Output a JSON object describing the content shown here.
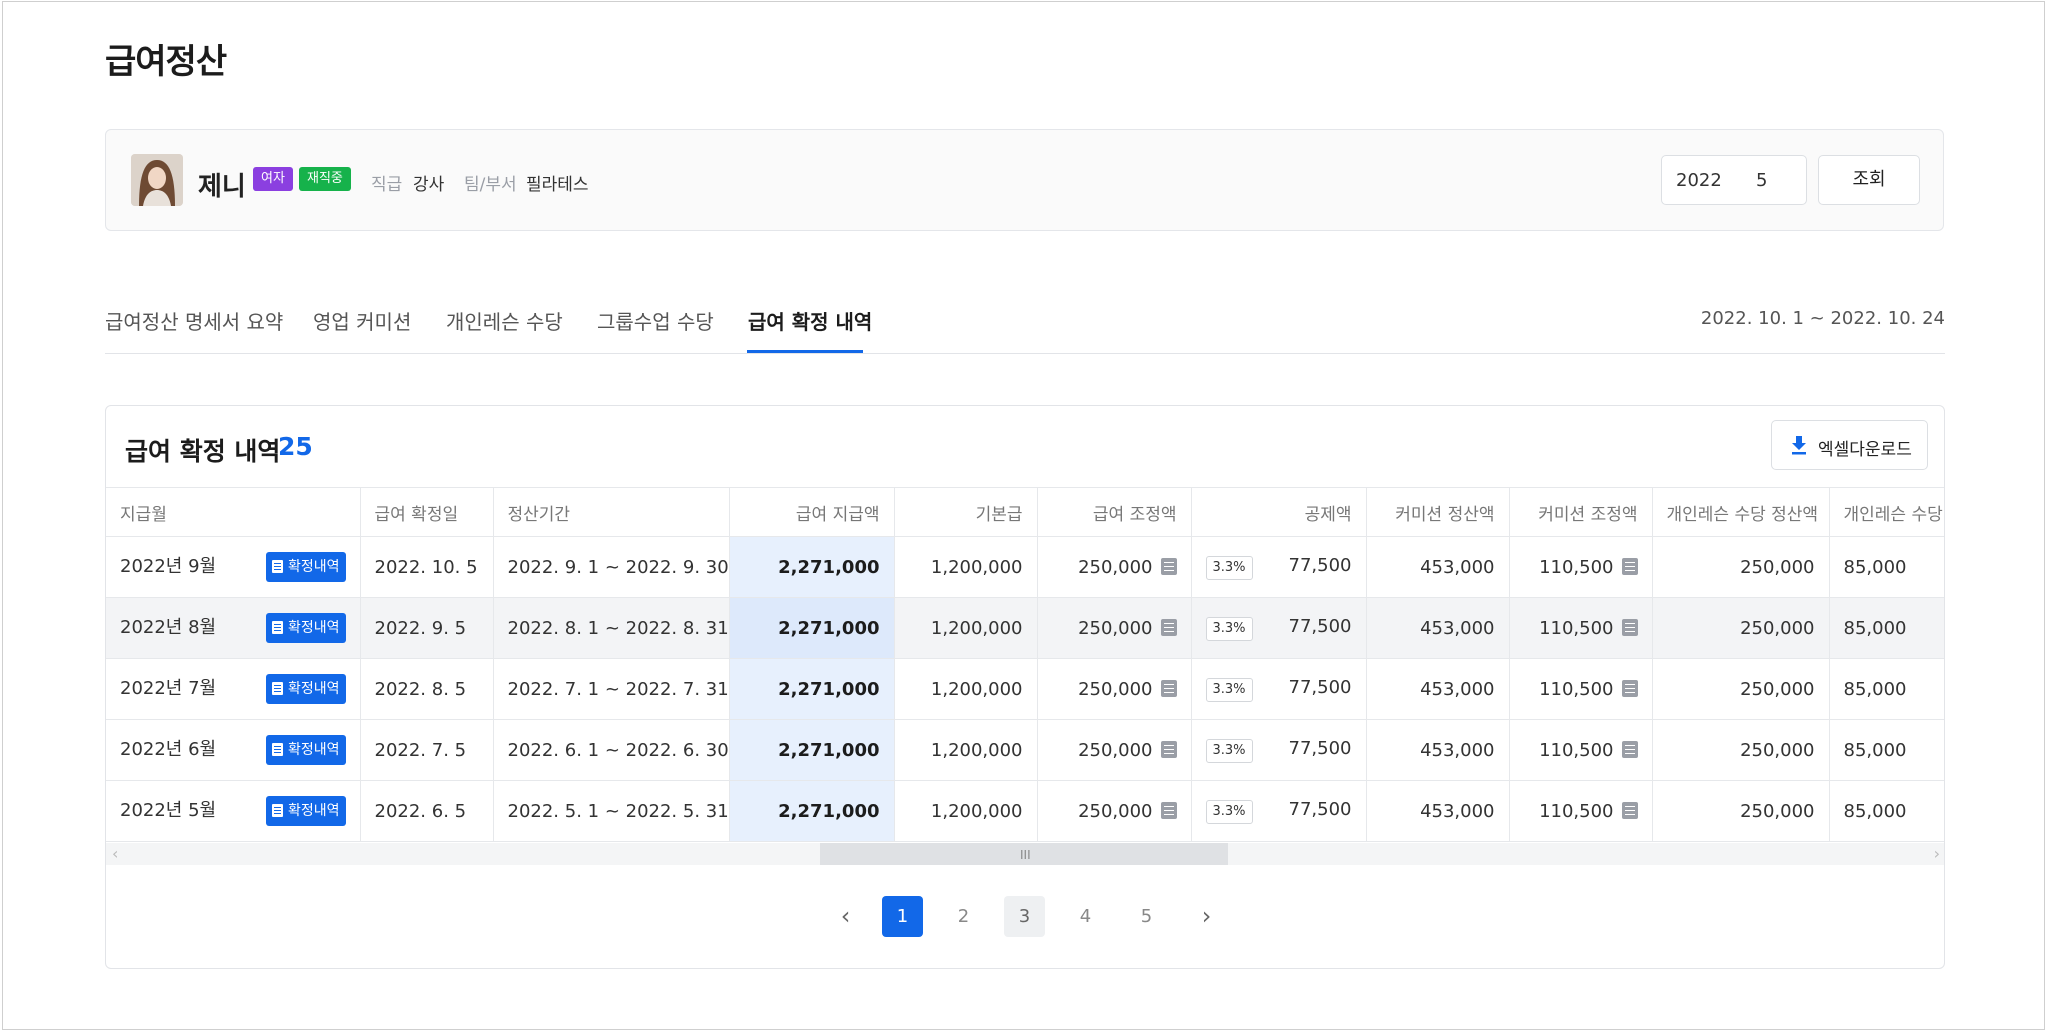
{
  "page": {
    "title": "급여정산"
  },
  "profile": {
    "name": "제니",
    "gender_badge": "여자",
    "status_badge": "재직중",
    "position_label": "직급",
    "position_value": "강사",
    "team_label": "팀/부서",
    "team_value": "필라테스",
    "year": "2022",
    "month": "5",
    "search_label": "조회"
  },
  "tabs": [
    {
      "label": "급여정산 명세서 요약",
      "active": false
    },
    {
      "label": "영업 커미션",
      "active": false
    },
    {
      "label": "개인레슨 수당",
      "active": false
    },
    {
      "label": "그룹수업 수당",
      "active": false
    },
    {
      "label": "급여 확정 내역",
      "active": true
    }
  ],
  "period": "2022. 10. 1 ~ 2022. 10. 24",
  "table": {
    "title": "급여 확정 내역",
    "count": "25",
    "excel_label": "엑셀다운로드",
    "confirm_label": "확정내역",
    "tax_label": "3.3%",
    "headers": [
      "지급월",
      "급여 확정일",
      "정산기간",
      "급여 지급액",
      "기본급",
      "급여 조정액",
      "공제액",
      "커미션 정산액",
      "커미션 조정액",
      "개인레슨 수당 정산액",
      "개인레슨 수당 조정액"
    ],
    "rows": [
      {
        "month": "2022년 9월",
        "confirm_date": "2022. 10. 5",
        "period": "2022. 9. 1 ~ 2022. 9. 30",
        "pay": "2,271,000",
        "base": "1,200,000",
        "adjust": "250,000",
        "deduct": "77,500",
        "commission": "453,000",
        "commission_adj": "110,500",
        "lesson": "250,000",
        "lesson_adj": "85,000"
      },
      {
        "month": "2022년 8월",
        "confirm_date": "2022. 9. 5",
        "period": "2022. 8. 1 ~ 2022. 8. 31",
        "pay": "2,271,000",
        "base": "1,200,000",
        "adjust": "250,000",
        "deduct": "77,500",
        "commission": "453,000",
        "commission_adj": "110,500",
        "lesson": "250,000",
        "lesson_adj": "85,000"
      },
      {
        "month": "2022년 7월",
        "confirm_date": "2022. 8. 5",
        "period": "2022. 7. 1 ~ 2022. 7. 31",
        "pay": "2,271,000",
        "base": "1,200,000",
        "adjust": "250,000",
        "deduct": "77,500",
        "commission": "453,000",
        "commission_adj": "110,500",
        "lesson": "250,000",
        "lesson_adj": "85,000"
      },
      {
        "month": "2022년 6월",
        "confirm_date": "2022. 7. 5",
        "period": "2022. 6. 1 ~ 2022. 6. 30",
        "pay": "2,271,000",
        "base": "1,200,000",
        "adjust": "250,000",
        "deduct": "77,500",
        "commission": "453,000",
        "commission_adj": "110,500",
        "lesson": "250,000",
        "lesson_adj": "85,000"
      },
      {
        "month": "2022년 5월",
        "confirm_date": "2022. 6. 5",
        "period": "2022. 5. 1 ~ 2022. 5. 31",
        "pay": "2,271,000",
        "base": "1,200,000",
        "adjust": "250,000",
        "deduct": "77,500",
        "commission": "453,000",
        "commission_adj": "110,500",
        "lesson": "250,000",
        "lesson_adj": "85,000"
      }
    ]
  },
  "pagination": {
    "pages": [
      "1",
      "2",
      "3",
      "4",
      "5"
    ],
    "current": "1"
  },
  "colors": {
    "accent": "#1268e8",
    "gender_badge": "#8b3fe0",
    "status_badge": "#16b24b",
    "pay_column_bg": "#e7f0fd"
  }
}
